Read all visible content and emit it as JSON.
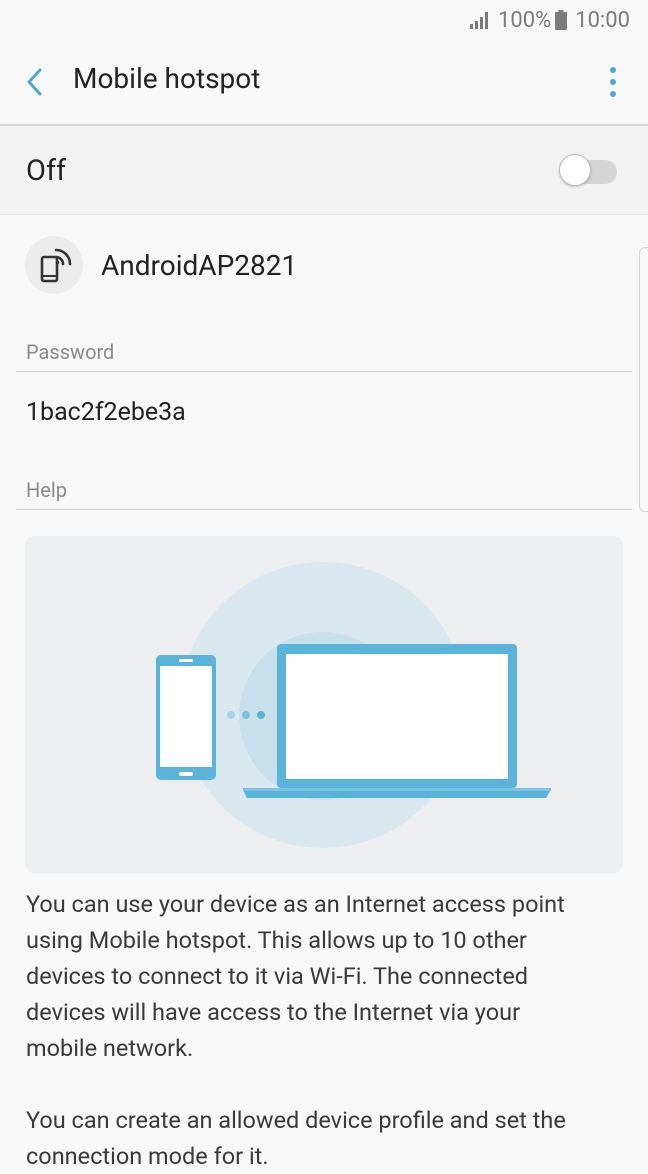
{
  "status_bar": {
    "battery": "100%",
    "time": "10:00"
  },
  "app_bar": {
    "title": "Mobile hotspot"
  },
  "hotspot": {
    "state_label": "Off",
    "enabled": false
  },
  "network": {
    "name": "AndroidAP2821"
  },
  "password": {
    "header": "Password",
    "value": "1bac2f2ebe3a"
  },
  "help": {
    "header": "Help",
    "paragraph1_lines": [
      "You can use your device as an Internet access point",
      "using Mobile hotspot. This allows up to 10 other",
      "devices to connect to it via Wi-Fi. The connected",
      "devices will have access to the Internet via your",
      "mobile network."
    ],
    "paragraph2_line": "You can create an allowed device profile and set the",
    "paragraph2_cut_line": "connection mode for it."
  },
  "colors": {
    "accent": "#4da9d2",
    "illustration_blue": "#5ab4d9",
    "halo_outer": "#d9e8ef",
    "halo_inner": "#c7e0ec"
  },
  "icons": [
    "back-arrow-icon",
    "more-options-icon",
    "hotspot-phone-icon",
    "signal-icon",
    "battery-icon"
  ]
}
